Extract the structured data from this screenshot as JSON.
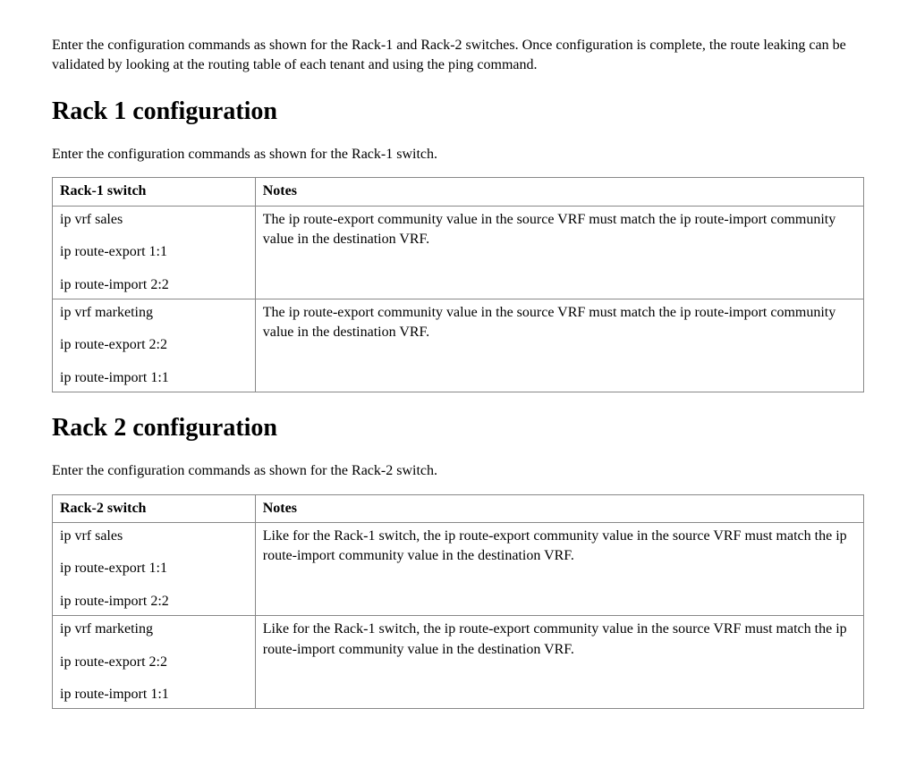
{
  "intro": "Enter the configuration commands as shown for the Rack-1 and Rack-2 switches. Once configuration is complete, the route leaking can be validated by looking at the routing table of each tenant and using the ping command.",
  "rack1": {
    "heading": "Rack 1 configuration",
    "intro": "Enter the configuration commands as shown for the Rack-1 switch.",
    "headers": {
      "switch": "Rack-1 switch",
      "notes": "Notes"
    },
    "rows": [
      {
        "cmd1": "ip vrf sales",
        "cmd2": "ip route-export 1:1",
        "cmd3": "ip route-import 2:2",
        "note": "The ip route-export community value in the source VRF must match the ip route-import community value in the destination VRF."
      },
      {
        "cmd1": "ip vrf marketing",
        "cmd2": "ip route-export 2:2",
        "cmd3": "ip route-import 1:1",
        "note": "The ip route-export community value in the source VRF must match the ip route-import community value in the destination VRF."
      }
    ]
  },
  "rack2": {
    "heading": "Rack 2 configuration",
    "intro": "Enter the configuration commands as shown for the Rack-2 switch.",
    "headers": {
      "switch": "Rack-2 switch",
      "notes": "Notes"
    },
    "rows": [
      {
        "cmd1": "ip vrf sales",
        "cmd2": "ip route-export 1:1",
        "cmd3": "ip route-import 2:2",
        "note": "Like for the Rack-1 switch, the ip route-export community value in the source VRF must match the ip route-import community value in the destination VRF."
      },
      {
        "cmd1": "ip vrf marketing",
        "cmd2": "ip route-export 2:2",
        "cmd3": "ip route-import 1:1",
        "note": "Like for the Rack-1 switch, the ip route-export community value in the source VRF must match the ip route-import community value in the destination VRF."
      }
    ]
  }
}
